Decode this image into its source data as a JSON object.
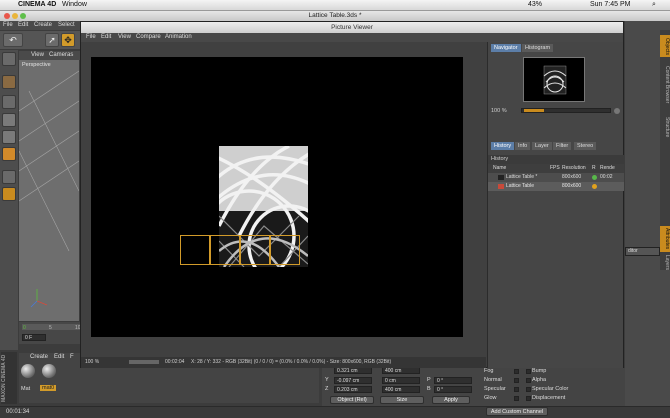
{
  "mac_menu": {
    "app_name": "CINEMA 4D",
    "window_menu": "Window",
    "battery": "43%",
    "clock": "Sun 7:45 PM"
  },
  "window_title": "Lattice Table.3ds *",
  "c4d_menu": [
    "File",
    "Edit",
    "Create",
    "Select"
  ],
  "viewport": {
    "menu": [
      "View",
      "Cameras"
    ],
    "label": "Perspective"
  },
  "timeline": {
    "start_tick": "0",
    "tick_5": "5",
    "tick_10": "10",
    "current_frame": "0 F",
    "end_frame": "0 F"
  },
  "material_panel": {
    "menu": [
      "Create",
      "Edit",
      "F"
    ],
    "materials": [
      "Mat",
      "mat0"
    ]
  },
  "status_time": "00:01:34",
  "picture_viewer": {
    "title": "Picture Viewer",
    "menu": [
      "File",
      "Edit",
      "View",
      "Compare",
      "Animation"
    ],
    "zoom": "100 %",
    "render_time": "00:02:04",
    "status": "X: 28 / Y: 332 - RGB (32Bit) (0 / 0 / 0) = (0.0% / 0.0% / 0.0%) - Size: 800x600, RGB (32Bit)"
  },
  "right_panel": {
    "top_tabs": [
      "Navigator",
      "Histogram"
    ],
    "nav_zoom": "100 %",
    "tabs": [
      "History",
      "Info",
      "Layer",
      "Filter",
      "Stereo"
    ],
    "history_title": "History",
    "columns": [
      "Name",
      "FPS",
      "Resolution",
      "R",
      "Rende"
    ],
    "rows": [
      {
        "name": "Lattice Table *",
        "resolution": "800x600",
        "status_color": "#58b84a",
        "time": "00:02"
      },
      {
        "name": "Lattice Table",
        "resolution": "800x600",
        "status_color": "#e0a11e",
        "time": ""
      }
    ]
  },
  "far_right": {
    "vtabs": [
      "Objects",
      "Content Browser",
      "Structure",
      "Attributes",
      "Layers"
    ],
    "editor_label": "ditor"
  },
  "coordinates": {
    "rows": [
      {
        "axis": "Y",
        "pos": "-0.097 cm",
        "size": "0 cm",
        "rot_label": "P",
        "rot": "0 °"
      },
      {
        "axis": "Z",
        "pos": "0.203 cm",
        "size": "400 cm",
        "rot_label": "B",
        "rot": "0 °"
      }
    ],
    "partial_row": {
      "pos": "0.321 cm",
      "size": "400 cm"
    },
    "object_mode": "Object (Rel)",
    "size_mode": "Size",
    "apply_label": "Apply"
  },
  "material_attributes": {
    "left": [
      "Fog",
      "Normal",
      "Specular",
      "Glow"
    ],
    "right": [
      "Bump",
      "Alpha",
      "Specular Color",
      "Displacement"
    ],
    "add_channel": "Add Custom Channel"
  },
  "colors": {
    "accent_blue": "#5c7ea8",
    "bucket_orange": "#d29b2a",
    "tab_orange": "#c98b1e"
  }
}
